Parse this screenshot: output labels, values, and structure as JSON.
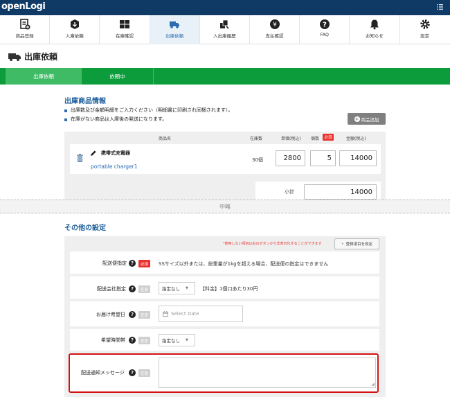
{
  "app": {
    "logo": "openLogi"
  },
  "nav": {
    "items": [
      {
        "label": "商品登録",
        "icon": "product-register-icon"
      },
      {
        "label": "入庫依頼",
        "icon": "inbound-icon"
      },
      {
        "label": "在庫確認",
        "icon": "inventory-icon"
      },
      {
        "label": "出庫依頼",
        "icon": "truck-icon",
        "active": true
      },
      {
        "label": "入出庫履歴",
        "icon": "history-icon"
      },
      {
        "label": "支払確認",
        "icon": "payment-icon"
      },
      {
        "label": "FAQ",
        "icon": "faq-icon"
      },
      {
        "label": "お知らせ",
        "icon": "bell-icon"
      },
      {
        "label": "設定",
        "icon": "gear-icon"
      }
    ]
  },
  "page": {
    "title": "出庫依頼"
  },
  "steps": [
    {
      "label": "出庫依頼",
      "active": true
    },
    {
      "label": "依頼中"
    }
  ],
  "products": {
    "title": "出庫商品情報",
    "notes": [
      "出庫数及び金額明細をご入力ください（明細書に印刷され同梱されます）。",
      "在庫がない商品は入庫後の発送になります。"
    ],
    "add_button": "商品追加",
    "headers": {
      "name": "商品名",
      "stock": "在庫数",
      "unit_price": "単価(税込)",
      "qty": "個数",
      "required": "必須",
      "amount": "金額(税込)"
    },
    "row": {
      "name": "携帯式充電器",
      "sub": "portable charger1",
      "stock": "30個",
      "unit_price": "2800",
      "qty": "5",
      "amount": "14000"
    },
    "subtotal": {
      "label": "小計",
      "value": "14000"
    }
  },
  "omitted": "中略",
  "settings": {
    "title": "その他の設定",
    "hint": "*使用しない項目は右のボタンから非表示化することができます",
    "register_button": "登録項目を設定",
    "rows": [
      {
        "label": "配送便指定",
        "badge": "必須",
        "value": "SSサイズ以外または、総重量が1kgを超える場合、配送便の指定はできません"
      },
      {
        "label": "配送会社指定",
        "badge": "任意",
        "select": "指定なし",
        "value": "【料金】1個口あたり30円"
      },
      {
        "label": "お届け希望日",
        "badge": "任意",
        "placeholder": "Select Date"
      },
      {
        "label": "希望時間帯",
        "badge": "任意",
        "select": "指定なし"
      },
      {
        "label": "配送通知メッセージ",
        "badge": "任意"
      }
    ]
  },
  "colors": {
    "header": "#0f3a66",
    "steps": "#0c9c3c",
    "accent": "#1f5f9c",
    "required": "#e8322f",
    "highlight": "#d31212"
  }
}
